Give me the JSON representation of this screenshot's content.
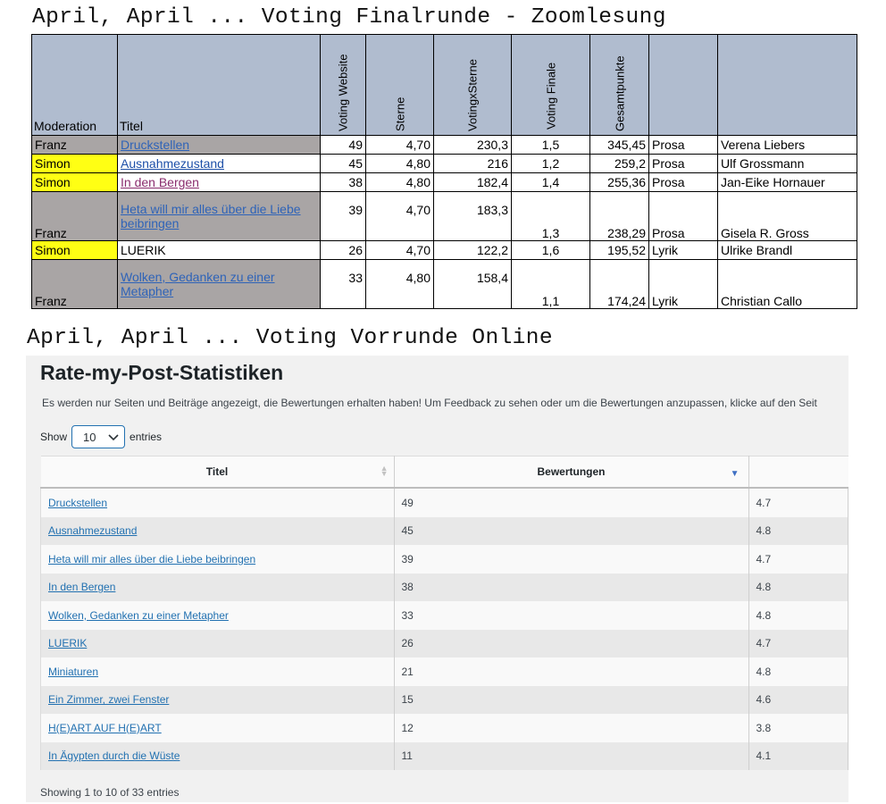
{
  "heading_top": "April, April ... Voting Finalrunde - Zoomlesung",
  "heading_bottom": "April, April ... Voting Vorrunde Online",
  "sheet": {
    "headers": [
      "Moderation",
      "Titel",
      "Voting Website",
      "Sterne",
      "VotingxSterne",
      "Voting Finale",
      "Gesamtpunkte",
      "",
      ""
    ],
    "rows": [
      {
        "mod": "Franz",
        "title": "Druckstellen",
        "votes": "49",
        "stars": "4,70",
        "vxs": "230,3",
        "final": "1,5",
        "total": "345,45",
        "genre": "Prosa",
        "author": "Verena Liebers"
      },
      {
        "mod": "Simon",
        "title": "Ausnahmezustand",
        "votes": "45",
        "stars": "4,80",
        "vxs": "216",
        "final": "1,2",
        "total": "259,2",
        "genre": "Prosa",
        "author": "Ulf Grossmann"
      },
      {
        "mod": "Simon",
        "title": "In den Bergen",
        "votes": "38",
        "stars": "4,80",
        "vxs": "182,4",
        "final": "1,4",
        "total": "255,36",
        "genre": "Prosa",
        "author": "Jan-Eike Hornauer"
      },
      {
        "mod": "Franz",
        "title_l1": "Heta will mir alles über die Liebe",
        "title_l2": "beibringen",
        "votes": "39",
        "stars": "4,70",
        "vxs": "183,3",
        "final": "1,3",
        "total": "238,29",
        "genre": "Prosa",
        "author": "Gisela R. Gross"
      },
      {
        "mod": "Simon",
        "title": "LUERIK",
        "votes": "26",
        "stars": "4,70",
        "vxs": "122,2",
        "final": "1,6",
        "total": "195,52",
        "genre": "Lyrik",
        "author": "Ulrike Brandl"
      },
      {
        "mod": "Franz",
        "title_l1": "Wolken, Gedanken zu einer",
        "title_l2": "Metapher",
        "votes": "33",
        "stars": "4,80",
        "vxs": "158,4",
        "final": "1,1",
        "total": "174,24",
        "genre": "Lyrik",
        "author": "Christian Callo"
      }
    ],
    "colors": {
      "header_bg": "#b0bccf",
      "franz_bg": "#a9a5a5",
      "simon_bg": "#ffff14"
    }
  },
  "stats": {
    "title": "Rate-my-Post-Statistiken",
    "description": "Es werden nur Seiten und Beiträge angezeigt, die Bewertungen erhalten haben! Um Feedback zu sehen oder um die Bewertungen anzupassen, klicke auf den Seit",
    "show_label": "Show",
    "entries_label": "entries",
    "page_length": "10",
    "columns": [
      "Titel",
      "Bewertungen"
    ],
    "rows": [
      {
        "title": "Druckstellen",
        "votes": "49",
        "avg": "4.7"
      },
      {
        "title": "Ausnahmezustand",
        "votes": "45",
        "avg": "4.8"
      },
      {
        "title": "Heta will mir alles über die Liebe beibringen",
        "votes": "39",
        "avg": "4.7"
      },
      {
        "title": "In den Bergen",
        "votes": "38",
        "avg": "4.8"
      },
      {
        "title": "Wolken, Gedanken zu einer Metapher",
        "votes": "33",
        "avg": "4.8"
      },
      {
        "title": "LUERIK",
        "votes": "26",
        "avg": "4.7"
      },
      {
        "title": "Miniaturen",
        "votes": "21",
        "avg": "4.8"
      },
      {
        "title": "Ein Zimmer, zwei Fenster",
        "votes": "15",
        "avg": "4.6"
      },
      {
        "title": "H(E)ART AUF H(E)ART",
        "votes": "12",
        "avg": "3.8"
      },
      {
        "title": "In Ägypten durch die Wüste",
        "votes": "11",
        "avg": "4.1"
      }
    ],
    "footer": "Showing 1 to 10 of 33 entries"
  }
}
